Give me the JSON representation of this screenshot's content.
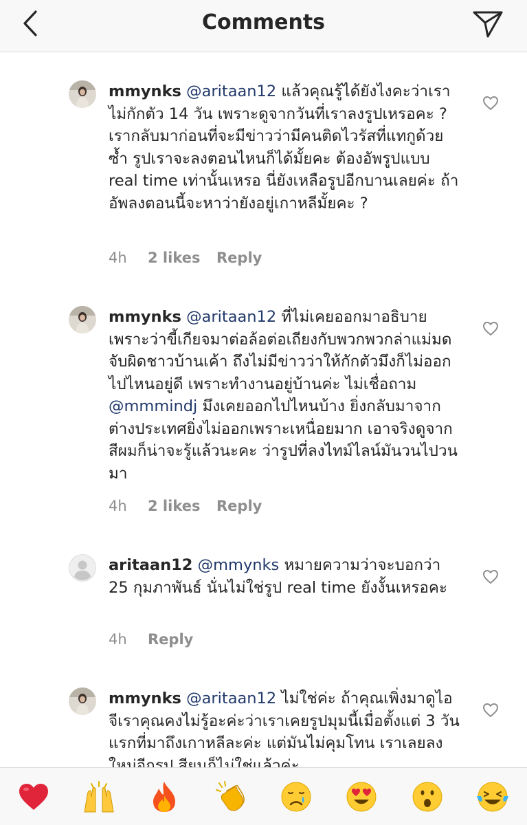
{
  "header": {
    "title": "Comments"
  },
  "comments": [
    {
      "username": "mmynks",
      "mention": "@aritaan12",
      "text": "แล้วคุณรู้ได้ยังไงคะว่าเราไม่กักตัว 14 วัน เพราะดูจากวันที่เราลงรูปเหรอคะ ? เรากลับมาก่อนที่จะมีข่าวว่ามีคนติดไวรัสที่แทกูด้วยซ้ำ รูปเราจะลงตอนไหนก็ได้มั้ยคะ ต้องอัพรูปแบบ real time เท่านั้นเหรอ นี่ยังเหลือรูปอีกบานเลยค่ะ ถ้าอัพลงตอนนี้จะหาว่ายังอยู่เกาหลีมั้ยคะ ?",
      "time": "4h",
      "likes": "2 likes",
      "reply": "Reply"
    },
    {
      "username": "mmynks",
      "mention": "@aritaan12",
      "text_before": "ที่ไม่เคยออกมาอธิบายเพราะว่าขี้เกียจมาต่อล้อต่อเถียงกับพวกพวกล่าแม่มด จับผิดชาวบ้านเค้า ถึงไม่มีข่าวว่าให้กักตัวมึงก็ไม่ออกไปไหนอยู่ดี เพราะทำงานอยู่บ้านค่ะ ไม่เชื่อถาม",
      "mention2": "@mmmindj",
      "text_after": "มึงเคยออกไปไหนบ้าง ยิ่งกลับมาจากต่างประเทศยิ่งไม่ออกเพราะเหนื่อยมาก เอาจริงดูจากสีผมก็น่าจะรู้แล้วนะคะ ว่ารูปที่ลงไทม์ไลน์มันวนไปวนมา",
      "time": "4h",
      "likes": "2 likes",
      "reply": "Reply"
    },
    {
      "username": "aritaan12",
      "mention": "@mmynks",
      "text": "หมายความว่าจะบอกว่า 25 กุมภาพันธ์ นั่นไม่ใช่รูป real time ยังงั้นเหรอคะ",
      "time": "4h",
      "reply": "Reply"
    },
    {
      "username": "mmynks",
      "mention": "@aritaan12",
      "text": "ไม่ใช่ค่ะ ถ้าคุณเพิ่งมาดูไอจีเราคุณคงไม่รู้อะค่ะว่าเราเคยรูปมุมนี้เมื่อตั้งแต่ 3 วันแรกที่มาถึงเกาหลีละค่ะ แต่มันไม่คุมโทน เราเลยลงใหม่อีกรูป สียนก็ไม่ใช่แล้วค่ะ"
    }
  ],
  "emoji_bar": [
    "❤️",
    "🙌",
    "🔥",
    "👏",
    "😢",
    "😍",
    "😮",
    "😂"
  ],
  "colors": {
    "mention": "#223a6b",
    "meta": "#8e8e8e",
    "text": "#262626",
    "bar_bg": "#f8f8f8"
  },
  "icons": {
    "back": "chevron-left-icon",
    "send": "paper-plane-icon",
    "like": "heart-outline-icon"
  }
}
